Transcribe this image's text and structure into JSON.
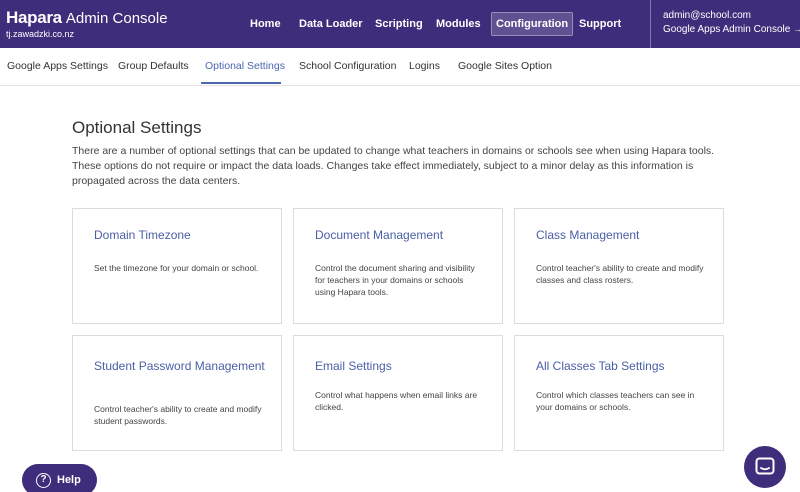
{
  "brand": {
    "logo": "Hapara",
    "subtitle": "Admin Console",
    "domain": "tj.zawadzki.co.nz"
  },
  "nav": {
    "items": [
      {
        "label": "Home"
      },
      {
        "label": "Data Loader"
      },
      {
        "label": "Scripting"
      },
      {
        "label": "Modules"
      },
      {
        "label": "Configuration",
        "active": true
      },
      {
        "label": "Support"
      }
    ]
  },
  "account": {
    "email": "admin@school.com",
    "link": "Google Apps Admin Console →"
  },
  "subtabs": [
    {
      "label": "Google Apps Settings"
    },
    {
      "label": "Group Defaults"
    },
    {
      "label": "Optional Settings",
      "active": true
    },
    {
      "label": "School Configuration"
    },
    {
      "label": "Logins"
    },
    {
      "label": "Google Sites Option"
    }
  ],
  "main": {
    "title": "Optional Settings",
    "intro": "There are a number of optional settings that can be updated to change what teachers in domains or schools see when using Hapara tools. These options do not require or impact the data loads. Changes take effect immediately, subject to a minor delay as this information is propagated across the data centers."
  },
  "cards": [
    {
      "title": "Domain Timezone",
      "desc": "Set the timezone for your domain or school."
    },
    {
      "title": "Document Management",
      "desc": "Control the document sharing and visibility for teachers in your domains or schools using Hapara tools."
    },
    {
      "title": "Class Management",
      "desc": "Control teacher's ability to create and modify classes and class rosters."
    },
    {
      "title": "Student Password Management",
      "desc": "Control teacher's ability to create and modify student passwords."
    },
    {
      "title": "Email Settings",
      "desc": "Control what happens when email links are clicked."
    },
    {
      "title": "All Classes Tab Settings",
      "desc": "Control which classes teachers can see in your domains or schools."
    }
  ],
  "help": {
    "icon": "?",
    "label": "Help"
  },
  "colors": {
    "topbar": "#3d2d7a",
    "accent": "#4a67b0",
    "card_title": "#4a5fa6"
  }
}
